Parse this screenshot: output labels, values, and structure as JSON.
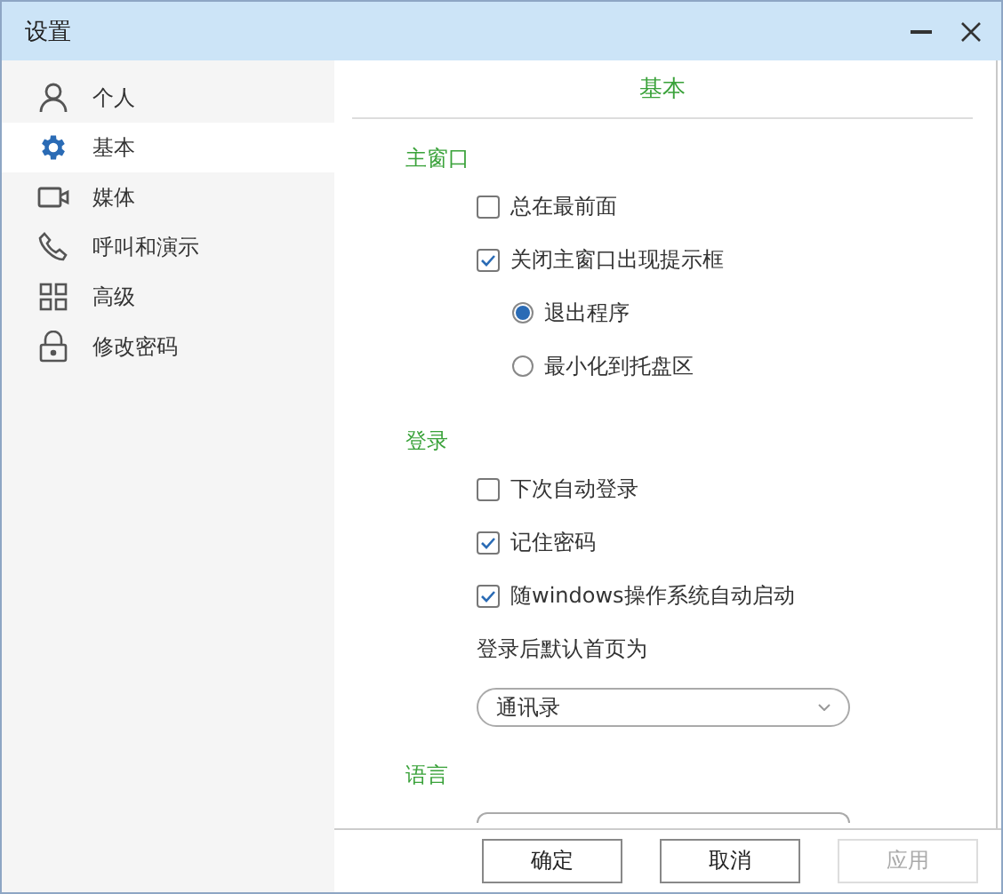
{
  "window": {
    "title": "设置"
  },
  "sidebar": {
    "items": [
      {
        "label": "个人",
        "selected": false
      },
      {
        "label": "基本",
        "selected": true
      },
      {
        "label": "媒体",
        "selected": false
      },
      {
        "label": "呼叫和演示",
        "selected": false
      },
      {
        "label": "高级",
        "selected": false
      },
      {
        "label": "修改密码",
        "selected": false
      }
    ]
  },
  "content": {
    "heading": "基本",
    "sections": [
      {
        "title": "主窗口",
        "items": [
          {
            "kind": "checkbox",
            "label": "总在最前面",
            "checked": false
          },
          {
            "kind": "checkbox",
            "label": "关闭主窗口出现提示框",
            "checked": true
          },
          {
            "kind": "radio",
            "label": "退出程序",
            "selected": true
          },
          {
            "kind": "radio",
            "label": "最小化到托盘区",
            "selected": false
          }
        ]
      },
      {
        "title": "登录",
        "items": [
          {
            "kind": "checkbox",
            "label": "下次自动登录",
            "checked": false
          },
          {
            "kind": "checkbox",
            "label": "记住密码",
            "checked": true
          },
          {
            "kind": "checkbox",
            "label": "随windows操作系统自动启动",
            "checked": true
          },
          {
            "kind": "label",
            "label": "登录后默认首页为"
          },
          {
            "kind": "dropdown",
            "value": "通讯录"
          }
        ]
      },
      {
        "title": "语言",
        "items": [
          {
            "kind": "dropdown"
          }
        ]
      }
    ]
  },
  "buttons": [
    {
      "label": "确定",
      "disabled": false
    },
    {
      "label": "取消",
      "disabled": false
    },
    {
      "label": "应用",
      "disabled": true
    }
  ]
}
